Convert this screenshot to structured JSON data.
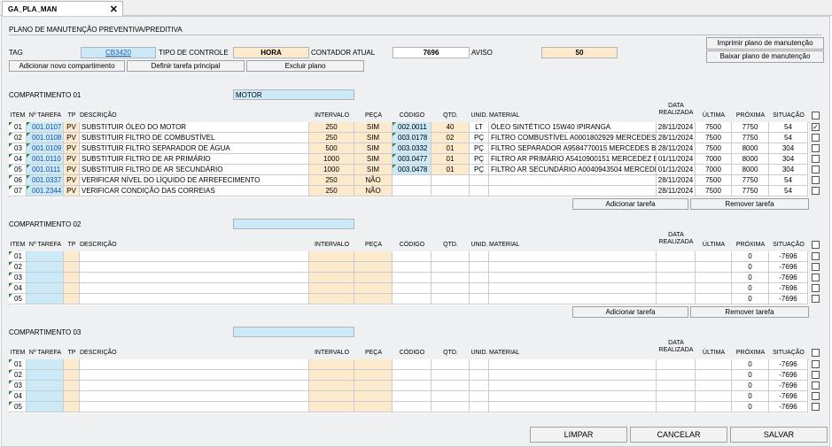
{
  "tab": {
    "label": "GA_PLA_MAN",
    "close": "✕"
  },
  "header": {
    "title": "PLANO DE MANUTENÇÃO PREVENTIVA/PREDITIVA"
  },
  "form": {
    "tag_label": "TAG",
    "tag_value": "CB3420",
    "tipo_label": "TIPO DE CONTROLE",
    "tipo_value": "HORA",
    "contador_label": "CONTADOR ATUAL",
    "contador_value": "7696",
    "aviso_label": "AVISO",
    "aviso_value": "50"
  },
  "actions": {
    "add_comp": "Adicionar novo compartimento",
    "def_task": "Definir tarefa principal",
    "del_plan": "Excluir plano",
    "print_plan": "Imprimir plano de manutenção",
    "download_plan": "Baixar plano de manutenção"
  },
  "columns": {
    "item": "ITEM",
    "tarefa": "Nº TAREFA",
    "tp": "TP",
    "descricao": "DESCRIÇÃO",
    "intervalo": "INTERVALO",
    "peca": "PEÇA",
    "codigo": "CÓDIGO",
    "qtd": "QTD.",
    "unid": "UNID.",
    "material": "MATERIAL",
    "data1": "DATA",
    "data2": "REALIZADA",
    "ultima": "ÚLTIMA",
    "proxima": "PRÓXIMA",
    "situacao": "SITUAÇÃO"
  },
  "sections": [
    {
      "title": "COMPARTIMENTO 01",
      "name": "MOTOR",
      "rows": [
        {
          "item": "01",
          "tarefa": "001.0107",
          "tp": "PV",
          "descricao": "SUBSTITUIR ÓLEO DO MOTOR",
          "intervalo": "250",
          "peca": "SIM",
          "codigo": "002.0011",
          "qtd": "40",
          "unid": "LT",
          "material": "ÓLEO SINTÉTICO 15W40 IPIRANGA",
          "data": "28/11/2024",
          "ultima": "7500",
          "proxima": "7750",
          "situacao": "54",
          "checked": true
        },
        {
          "item": "02",
          "tarefa": "001.0108",
          "tp": "PV",
          "descricao": "SUBSTITUIR FILTRO DE COMBUSTÍVEL",
          "intervalo": "250",
          "peca": "SIM",
          "codigo": "003.0178",
          "qtd": "02",
          "unid": "PÇ",
          "material": "FILTRO COMBUSTÍVEL A0001802929 MERCEDES BENZ",
          "data": "28/11/2024",
          "ultima": "7500",
          "proxima": "7750",
          "situacao": "54",
          "checked": false
        },
        {
          "item": "03",
          "tarefa": "001.0109",
          "tp": "PV",
          "descricao": "SUBSTITUIR FILTRO SEPARADOR DE ÁGUA",
          "intervalo": "500",
          "peca": "SIM",
          "codigo": "003.0332",
          "qtd": "01",
          "unid": "PÇ",
          "material": "FILTRO SEPARADOR A9584770015 MERCEDES BENZ",
          "data": "28/11/2024",
          "ultima": "7500",
          "proxima": "8000",
          "situacao": "304",
          "checked": false
        },
        {
          "item": "04",
          "tarefa": "001.0110",
          "tp": "PV",
          "descricao": "SUBSTITUIR FILTRO DE AR PRIMÁRIO",
          "intervalo": "1000",
          "peca": "SIM",
          "codigo": "003.0477",
          "qtd": "01",
          "unid": "PÇ",
          "material": "FILTRO AR PRIMÁRIO A5410900151 MERCEDEZ BENZ",
          "data": "01/11/2024",
          "ultima": "7000",
          "proxima": "8000",
          "situacao": "304",
          "checked": false
        },
        {
          "item": "05",
          "tarefa": "001.0111",
          "tp": "PV",
          "descricao": "SUBSTITUIR FILTRO DE AR SECUNDÁRIO",
          "intervalo": "1000",
          "peca": "SIM",
          "codigo": "003.0478",
          "qtd": "01",
          "unid": "PÇ",
          "material": "FILTRO AR SECUNDÁRIO A0040943504 MERCEDES BENZ",
          "data": "01/11/2024",
          "ultima": "7000",
          "proxima": "8000",
          "situacao": "304",
          "checked": false
        },
        {
          "item": "06",
          "tarefa": "001.0337",
          "tp": "PV",
          "descricao": "VERIFICAR NÍVEL DO LÍQUIDO DE ARREFECIMENTO",
          "intervalo": "250",
          "peca": "NÃO",
          "codigo": "",
          "qtd": "",
          "unid": "",
          "material": "",
          "data": "28/11/2024",
          "ultima": "7500",
          "proxima": "7750",
          "situacao": "54",
          "checked": false
        },
        {
          "item": "07",
          "tarefa": "001.2344",
          "tp": "PV",
          "descricao": "VERIFICAR CONDIÇÃO DAS CORREIAS",
          "intervalo": "250",
          "peca": "NÃO",
          "codigo": "",
          "qtd": "",
          "unid": "",
          "material": "",
          "data": "28/11/2024",
          "ultima": "7500",
          "proxima": "7750",
          "situacao": "54",
          "checked": false
        }
      ],
      "add_task": "Adicionar tarefa",
      "remove_task": "Remover tarefa"
    },
    {
      "title": "COMPARTIMENTO 02",
      "name": "",
      "rows": [
        {
          "item": "01",
          "proxima": "0",
          "situacao": "-7696"
        },
        {
          "item": "02",
          "proxima": "0",
          "situacao": "-7696"
        },
        {
          "item": "03",
          "proxima": "0",
          "situacao": "-7696"
        },
        {
          "item": "04",
          "proxima": "0",
          "situacao": "-7696"
        },
        {
          "item": "05",
          "proxima": "0",
          "situacao": "-7696"
        }
      ],
      "add_task": "Adicionar tarefa",
      "remove_task": "Remover tarefa"
    },
    {
      "title": "COMPARTIMENTO 03",
      "name": "",
      "rows": [
        {
          "item": "01",
          "proxima": "0",
          "situacao": "-7696"
        },
        {
          "item": "02",
          "proxima": "0",
          "situacao": "-7696"
        },
        {
          "item": "03",
          "proxima": "0",
          "situacao": "-7696"
        },
        {
          "item": "04",
          "proxima": "0",
          "situacao": "-7696"
        },
        {
          "item": "05",
          "proxima": "0",
          "situacao": "-7696"
        }
      ]
    }
  ],
  "footer": {
    "limpar": "LIMPAR",
    "cancelar": "CANCELAR",
    "salvar": "SALVAR"
  }
}
